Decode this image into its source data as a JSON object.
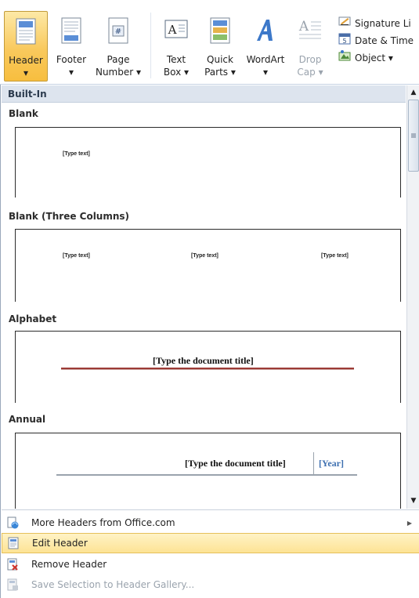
{
  "ribbon": {
    "header": {
      "label": "Header",
      "arrow": "▾"
    },
    "footer": {
      "label": "Footer",
      "arrow": "▾"
    },
    "page_number": {
      "label1": "Page",
      "label2": "Number ▾"
    },
    "text_box": {
      "label1": "Text",
      "label2": "Box ▾"
    },
    "quick_parts": {
      "label1": "Quick",
      "label2": "Parts ▾"
    },
    "wordart": {
      "label": "WordArt",
      "arrow": "▾"
    },
    "drop_cap": {
      "label1": "Drop",
      "label2": "Cap ▾"
    },
    "signature_line": "Signature Li",
    "date_time": "Date & Time",
    "object": "Object ▾"
  },
  "gallery": {
    "category": "Built-In",
    "items": [
      {
        "title": "Blank",
        "placeholders": [
          "[Type text]"
        ]
      },
      {
        "title": "Blank (Three Columns)",
        "placeholders": [
          "[Type text]",
          "[Type text]",
          "[Type text]"
        ]
      },
      {
        "title": "Alphabet",
        "placeholders": [
          "[Type the document title]"
        ]
      },
      {
        "title": "Annual",
        "placeholders": [
          "[Type the document title]",
          "[Year]"
        ]
      }
    ]
  },
  "menu": {
    "more_headers": "More Headers from Office.com",
    "edit_header": "Edit Header",
    "remove_header": "Remove Header",
    "save_selection": "Save Selection to Header Gallery..."
  },
  "colors": {
    "selected_gradient_top": "#fde9a6",
    "selected_gradient_bottom": "#f7be3f",
    "alphabet_rule": "#9c3b36",
    "annual_year": "#3d6fb0",
    "category_band": "#dde4ee"
  }
}
